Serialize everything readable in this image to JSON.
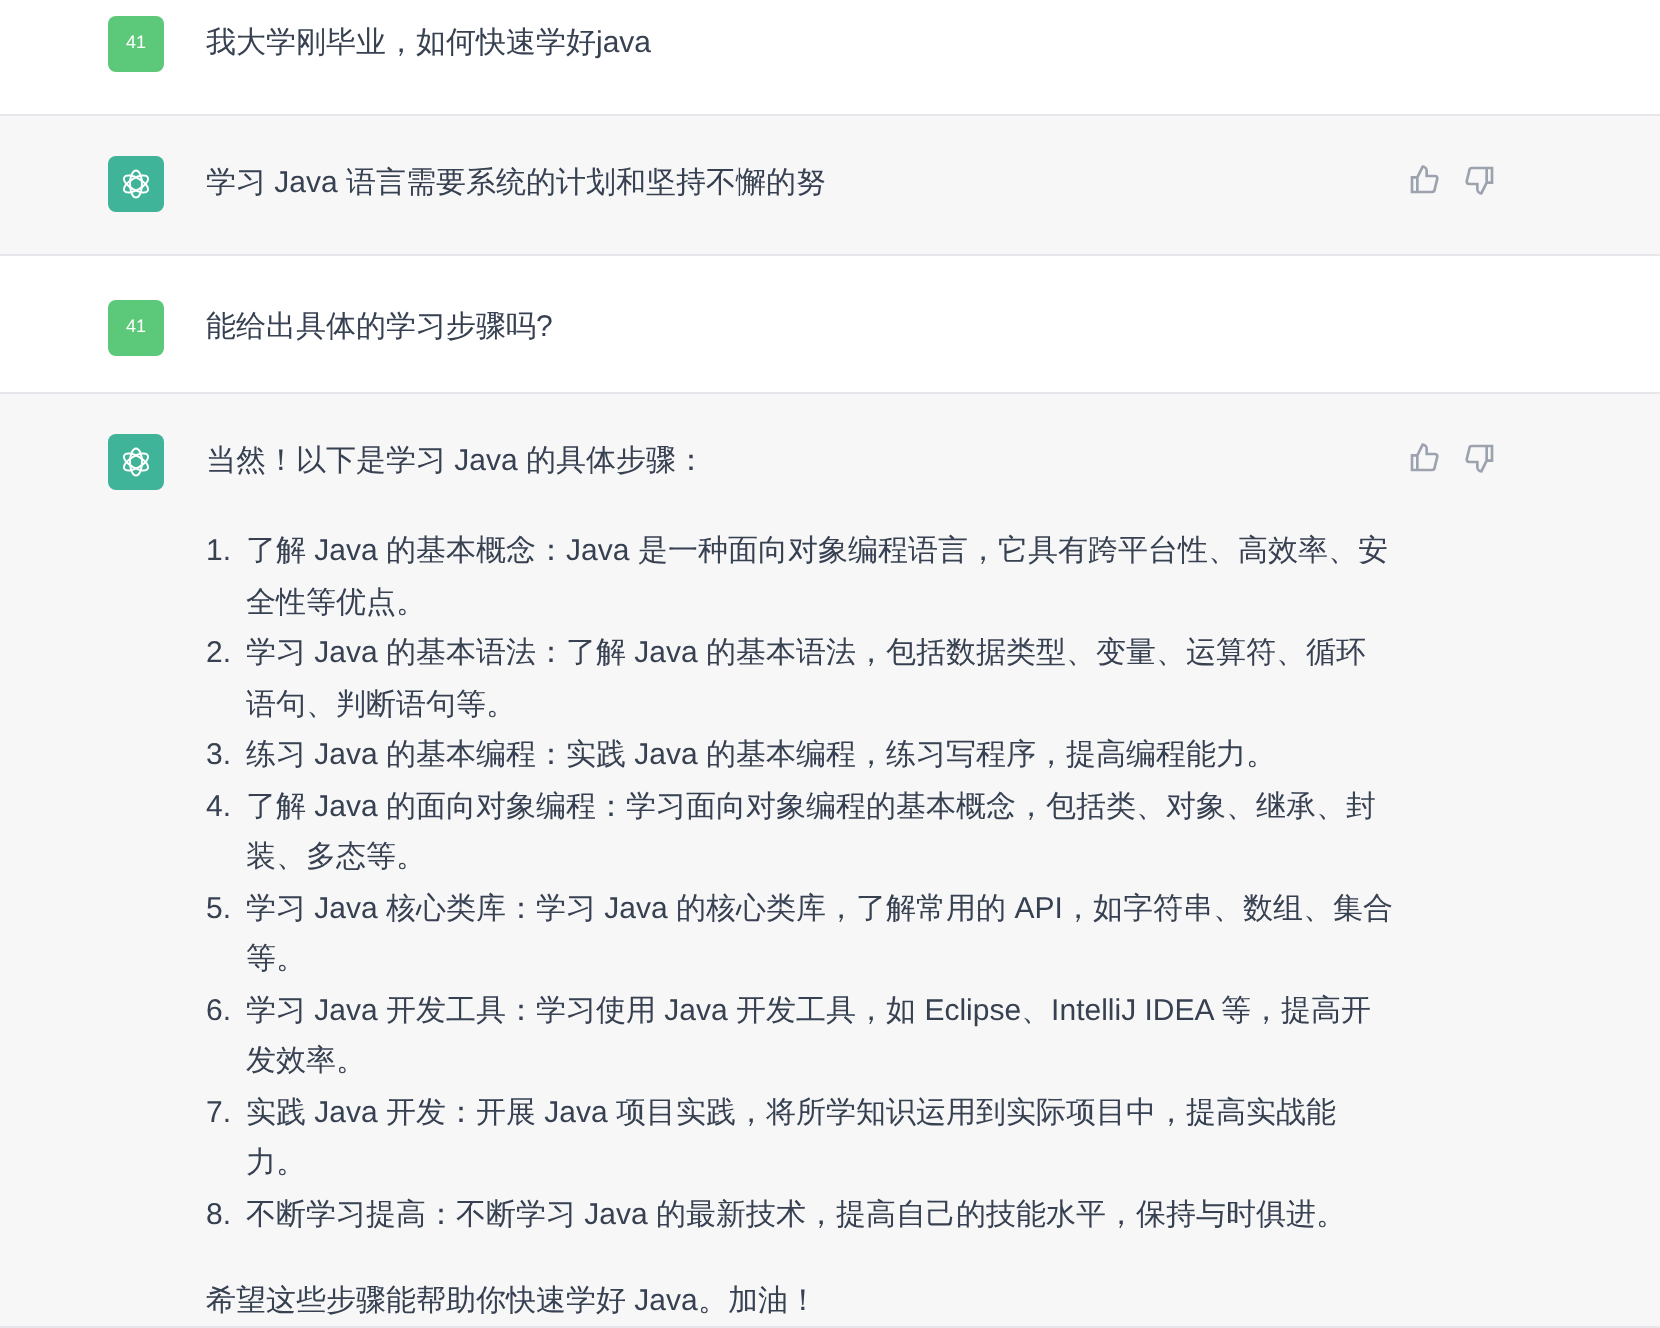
{
  "messages": [
    {
      "kind": "user",
      "avatar": "41",
      "text": "我大学刚毕业，如何快速学好java"
    },
    {
      "kind": "assistant",
      "text": "学习 Java 语言需要系统的计划和坚持不懈的努"
    },
    {
      "kind": "user",
      "avatar": "41",
      "text": "能给出具体的学习步骤吗?"
    },
    {
      "kind": "assistant",
      "text": "当然！以下是学习 Java 的具体步骤：",
      "steps": [
        {
          "number": "1.",
          "text": "了解 Java 的基本概念：Java 是一种面向对象编程语言，它具有跨平台性、高效率、安全性等优点。"
        },
        {
          "number": "2.",
          "text": "学习 Java 的基本语法：了解 Java 的基本语法，包括数据类型、变量、运算符、循环语句、判断语句等。"
        },
        {
          "number": "3.",
          "text": "练习 Java 的基本编程：实践 Java 的基本编程，练习写程序，提高编程能力。"
        },
        {
          "number": "4.",
          "text": "了解 Java 的面向对象编程：学习面向对象编程的基本概念，包括类、对象、继承、封装、多态等。"
        },
        {
          "number": "5.",
          "text": "学习 Java 核心类库：学习 Java 的核心类库，了解常用的 API，如字符串、数组、集合等。"
        },
        {
          "number": "6.",
          "text": "学习 Java 开发工具：学习使用 Java 开发工具，如 Eclipse、IntelliJ IDEA 等，提高开发效率。"
        },
        {
          "number": "7.",
          "text": "实践 Java 开发：开展 Java 项目实践，将所学知识运用到实际项目中，提高实战能力。"
        },
        {
          "number": "8.",
          "text": "不断学习提高：不断学习 Java 的最新技术，提高自己的技能水平，保持与时俱进。"
        }
      ],
      "closing": "希望这些步骤能帮助你快速学好 Java。加油！"
    }
  ]
}
